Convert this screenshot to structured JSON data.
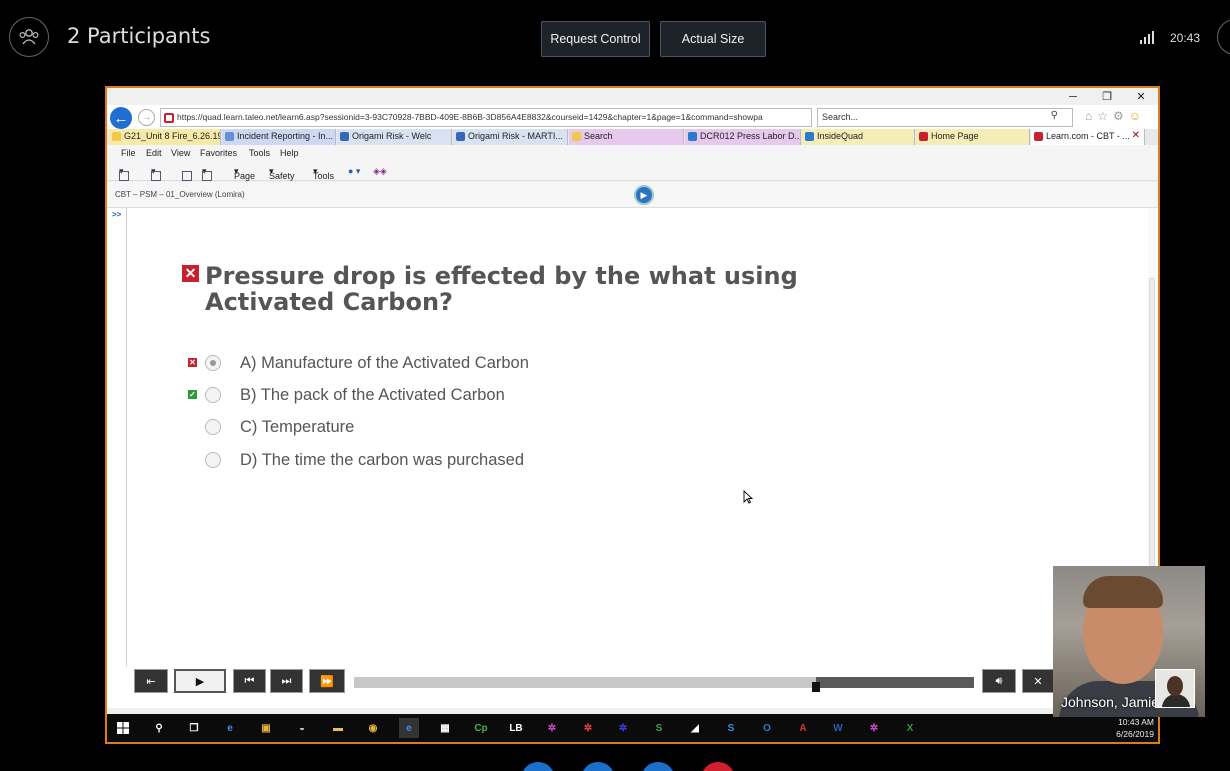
{
  "meeting": {
    "participants_label": "2 Participants",
    "request_control": "Request Control",
    "actual_size": "Actual Size",
    "clock": "20:43"
  },
  "browser": {
    "url": "https://quad.learn.taleo.net/learn6.asp?sessionid=3-93C70928-7BBD-409E-8B6B-3D856A4E8832&courseid=1429&chapter=1&page=1&command=showpa",
    "search_placeholder": "Search...",
    "tabs": [
      {
        "label": "G21_Unit 8 Fire_6.26.19...",
        "color": "#f2c94c"
      },
      {
        "label": "Incident Reporting - In...",
        "color": "#6a8fd6"
      },
      {
        "label": "Origami Risk - Welc",
        "color": "#3a66b8"
      },
      {
        "label": "Origami Risk - MARTI...",
        "color": "#3a66b8"
      },
      {
        "label": "Search",
        "color": "#f2c94c"
      },
      {
        "label": "DCR012 Press Labor D...",
        "color": "#2a7ad0"
      },
      {
        "label": "InsideQuad",
        "color": "#2a7ad0"
      },
      {
        "label": "Home Page",
        "color": "#c8202f"
      },
      {
        "label": "Learn.com - CBT - ...",
        "color": "#c8202f"
      }
    ],
    "menu": [
      "File",
      "Edit",
      "View",
      "Favorites",
      "Tools",
      "Help"
    ],
    "commands": {
      "page": "Page",
      "safety": "Safety",
      "tools": "Tools"
    }
  },
  "course": {
    "title": "CBT – PSM – 01_Overview (Lomira)",
    "gutter_arrow": ">>",
    "question": "Pressure drop is effected by the what using Activated Carbon?",
    "answers": [
      {
        "label": "A) Manufacture of the Activated Carbon",
        "selected": true,
        "mark": "wrong"
      },
      {
        "label": "B) The pack of the Activated Carbon",
        "selected": false,
        "mark": "correct"
      },
      {
        "label": "C) Temperature",
        "selected": false,
        "mark": "none"
      },
      {
        "label": "D) The time the carbon was purchased",
        "selected": false,
        "mark": "none"
      }
    ],
    "progress_fraction": 0.745
  },
  "taskbar": {
    "time": "10:43 AM",
    "date": "6/26/2019"
  },
  "webcam": {
    "name": "Johnson, Jamie"
  }
}
